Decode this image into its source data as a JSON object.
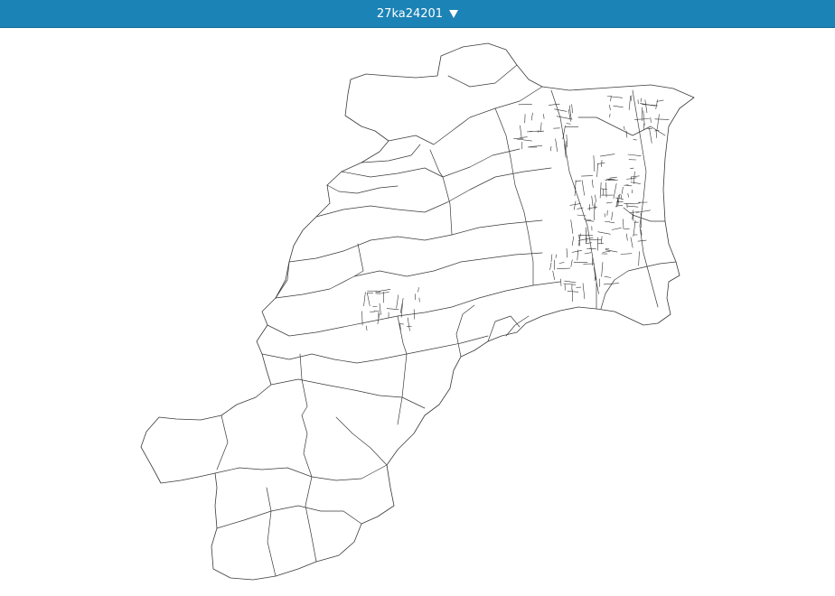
{
  "header": {
    "dataset_code": "27ka24201"
  },
  "map": {
    "boundary_color": "#3a3a3a",
    "fill_color": "#ffffff",
    "header_color": "#1b83b6"
  },
  "icons": {
    "dropdown": "caret-down-icon"
  }
}
